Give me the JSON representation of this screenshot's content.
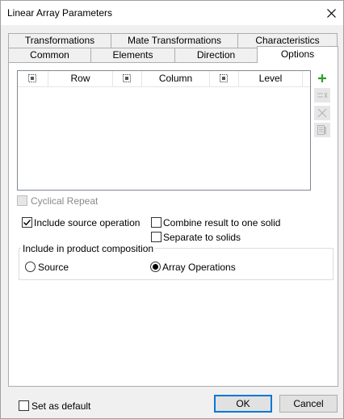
{
  "window": {
    "title": "Linear Array Parameters"
  },
  "tabs": {
    "row1": [
      "Transformations",
      "Mate Transformations",
      "Characteristics"
    ],
    "row2": [
      "Common",
      "Elements",
      "Direction",
      "Options"
    ],
    "active": "Options"
  },
  "grid": {
    "columns": [
      "Row",
      "Column",
      "Level"
    ],
    "rows": []
  },
  "side_buttons": [
    {
      "icon": "add-icon",
      "enabled": true,
      "color": "#2e9e2e"
    },
    {
      "icon": "remove-icon",
      "enabled": false
    },
    {
      "icon": "delete-icon",
      "enabled": false
    },
    {
      "icon": "properties-icon",
      "enabled": false
    }
  ],
  "options": {
    "cyclical_repeat": {
      "label": "Cyclical Repeat",
      "checked": false,
      "enabled": false
    },
    "include_source": {
      "label": "Include source operation",
      "checked": true
    },
    "combine_result": {
      "label": "Combine result to one solid",
      "checked": false
    },
    "separate_solids": {
      "label": "Separate to solids",
      "checked": false
    }
  },
  "composition": {
    "title": "Include in product composition",
    "source_label": "Source",
    "array_label": "Array Operations",
    "selected": "Array Operations"
  },
  "footer": {
    "set_default_label": "Set as default",
    "ok_label": "OK",
    "cancel_label": "Cancel"
  }
}
